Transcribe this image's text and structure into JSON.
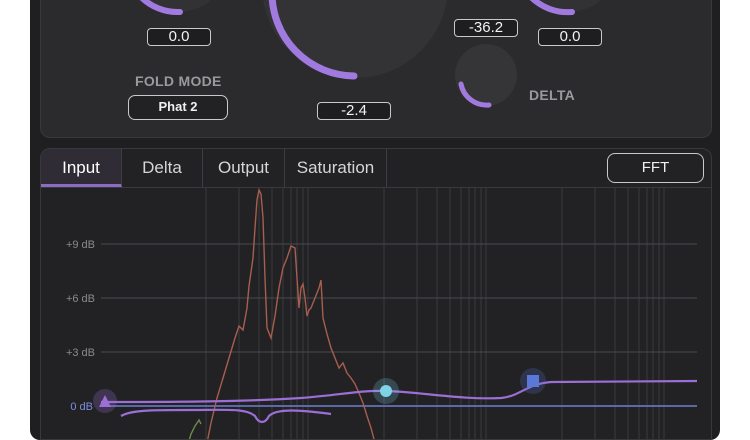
{
  "top": {
    "knob_left": {
      "value": "0.0"
    },
    "knob_center": {
      "value": "-2.4"
    },
    "knob_top_right": {
      "value": "-36.2"
    },
    "knob_right": {
      "value": "0.0"
    },
    "fold_mode": {
      "caption": "FOLD MODE",
      "selected": "Phat 2"
    },
    "delta": {
      "caption": "DELTA"
    }
  },
  "tabs": [
    {
      "label": "Input",
      "active": true
    },
    {
      "label": "Delta",
      "active": false
    },
    {
      "label": "Output",
      "active": false
    },
    {
      "label": "Saturation",
      "active": false
    }
  ],
  "fft_button": {
    "label": "FFT"
  },
  "graph": {
    "db_labels": [
      "+9 dB",
      "+6 dB",
      "+3 dB",
      "0 dB"
    ],
    "colors": {
      "accent": "#9b6fd6",
      "spectrum": "#a75e4e",
      "spectrum_green": "#6b8a4a",
      "node_cyan": "#7fd3e6",
      "node_blue": "#5a78d8",
      "zero_line": "#6d7fd0",
      "meter_green": "#5bc77a"
    }
  },
  "icons": [
    "triangle-node-icon",
    "circle-node-icon",
    "square-node-icon"
  ]
}
